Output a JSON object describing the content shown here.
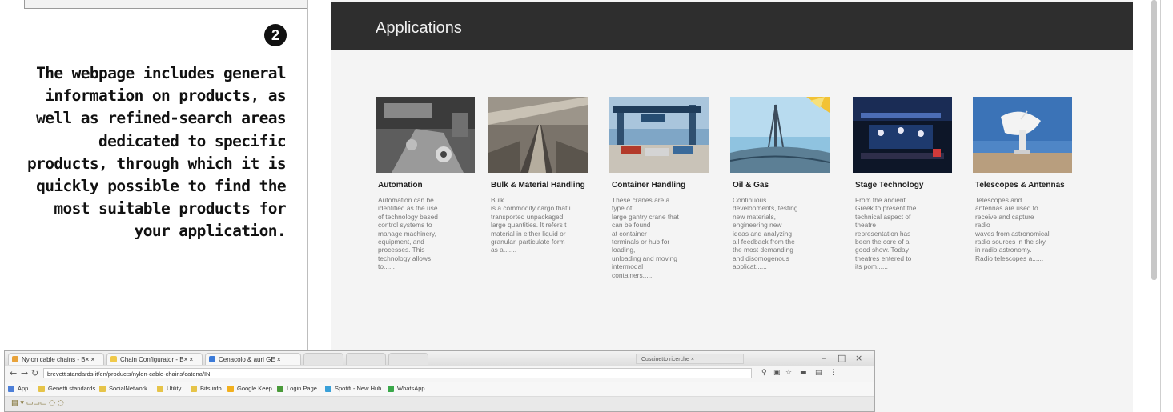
{
  "caption": {
    "step_number": "2",
    "text": "The webpage includes general information on products, as well as refined-search areas dedicated to specific products, through which it is quickly possible to find the most suitable products for your application."
  },
  "section": {
    "title": "Applications"
  },
  "cards": [
    {
      "title": "Automation",
      "description": "Automation can be\nidentified as the use\nof technology based\ncontrol systems to\nmanage machinery,\nequipment, and\nprocesses. This\ntechnology allows\nto......",
      "image_icon": "automation-photo"
    },
    {
      "title": "Bulk & Material\nHandling",
      "description": "Bulk\nis a commodity cargo that i\ntransported unpackaged\nlarge quantities. It refers t\nmaterial in either liquid or\ngranular, particulate form\nas a.......",
      "image_icon": "conveyor-photo"
    },
    {
      "title": "Container\nHandling",
      "description": "These cranes are a\ntype of\nlarge gantry crane that\ncan be found\nat container\nterminals or hub for\nloading,\nunloading and moving\nintermodal\ncontainers......",
      "image_icon": "container-crane-photo"
    },
    {
      "title": "Oil & Gas",
      "description": "Continuous\ndevelopments, testing\nnew materials,\nengineering new\nideas and analyzing\nall feedback from the\nthe most demanding\nand disomogenous\napplicat......",
      "image_icon": "oil-rig-photo"
    },
    {
      "title": "Stage Technology",
      "description": "From the ancient\nGreek to present the\ntechnical aspect of\ntheatre\nrepresentation has\nbeen the core of a\ngood show. Today\ntheatres entered to\nits pom......",
      "image_icon": "stage-photo"
    },
    {
      "title": "Telescopes &\nAntennas",
      "description": "Telescopes and\nantennas are used to\nreceive and capture\nradio\nwaves from astronomical\nradio sources in the sky\nin radio astronomy.\nRadio telescopes a......",
      "image_icon": "radio-telescope-photo"
    }
  ],
  "browser": {
    "tabs": [
      {
        "label": "Nylon cable chains - B× ×",
        "color": "#e8a23a"
      },
      {
        "label": "Chain Configurator - B× ×",
        "color": "#f0c94a"
      },
      {
        "label": "Cenacolo & auri GE ×",
        "color": "#3b7ad8"
      }
    ],
    "search_box": "Cuscinetto ricerche ×",
    "url": "brevettistandards.it/en/products/nylon-cable-chains/catena/IN",
    "bookmarks": [
      {
        "label": "App",
        "color": "#4d7fd8"
      },
      {
        "label": "Genetti standards",
        "color": "#e6c449"
      },
      {
        "label": "SocialNetwork",
        "color": "#e6c449"
      },
      {
        "label": "Utility",
        "color": "#e6c449"
      },
      {
        "label": "Bits info",
        "color": "#e6c449"
      },
      {
        "label": "Google Keep",
        "color": "#f2b01e"
      },
      {
        "label": "Login Page",
        "color": "#4a9a3a"
      },
      {
        "label": "Spotifi - New Hub",
        "color": "#3aa0d8"
      },
      {
        "label": "WhatsApp",
        "color": "#3aa84a"
      }
    ]
  }
}
